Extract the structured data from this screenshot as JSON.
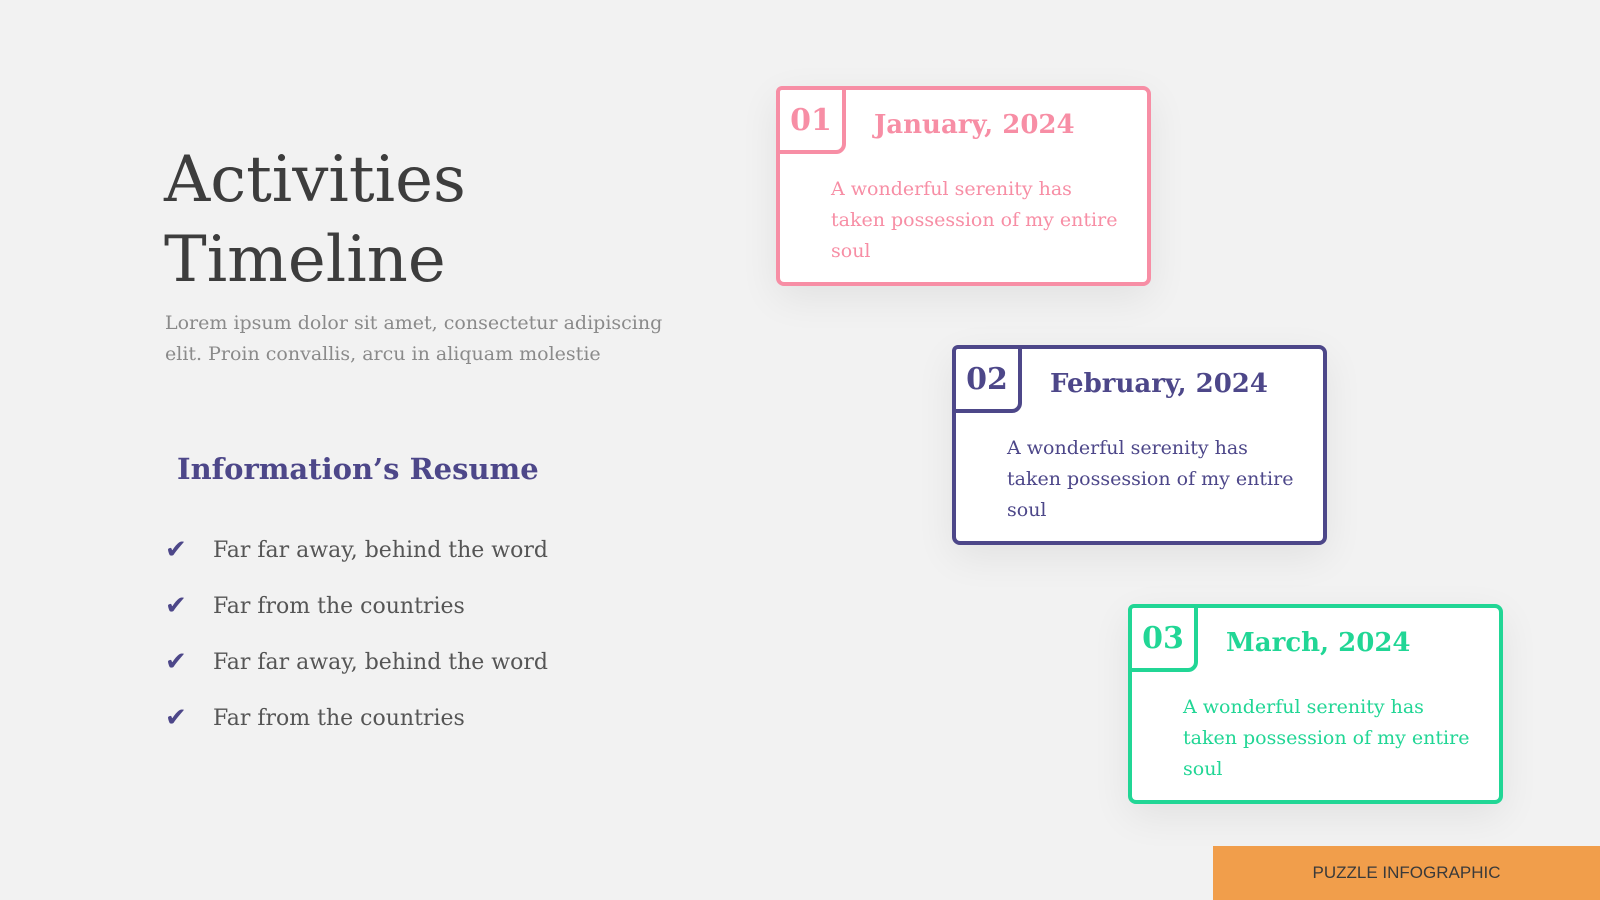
{
  "heading": {
    "line1": "Activities",
    "line2": "Timeline"
  },
  "subtitle": "Lorem ipsum dolor sit amet, consectetur adipiscing elit. Proin convallis, arcu in aliquam molestie",
  "resume": {
    "title": "Information’s Resume",
    "items": [
      {
        "icon": "check-icon",
        "text": "Far far away, behind the word"
      },
      {
        "icon": "check-icon",
        "text": "Far from the countries"
      },
      {
        "icon": "check-icon",
        "text": "Far far away, behind the word"
      },
      {
        "icon": "check-icon",
        "text": "Far from the countries"
      }
    ]
  },
  "timeline": [
    {
      "number": "01",
      "month": "January, 2024",
      "description": "A wonderful serenity has taken possession of my entire soul",
      "color": "#f78ea5"
    },
    {
      "number": "02",
      "month": "February, 2024",
      "description": "A wonderful serenity has taken possession of my entire soul",
      "color": "#4d4789"
    },
    {
      "number": "03",
      "month": "March, 2024",
      "description": "A wonderful serenity has taken possession of my entire soul",
      "color": "#21d695"
    }
  ],
  "footer": {
    "label": "PUZZLE INFOGRAPHIC",
    "color": "#f19e4b"
  }
}
